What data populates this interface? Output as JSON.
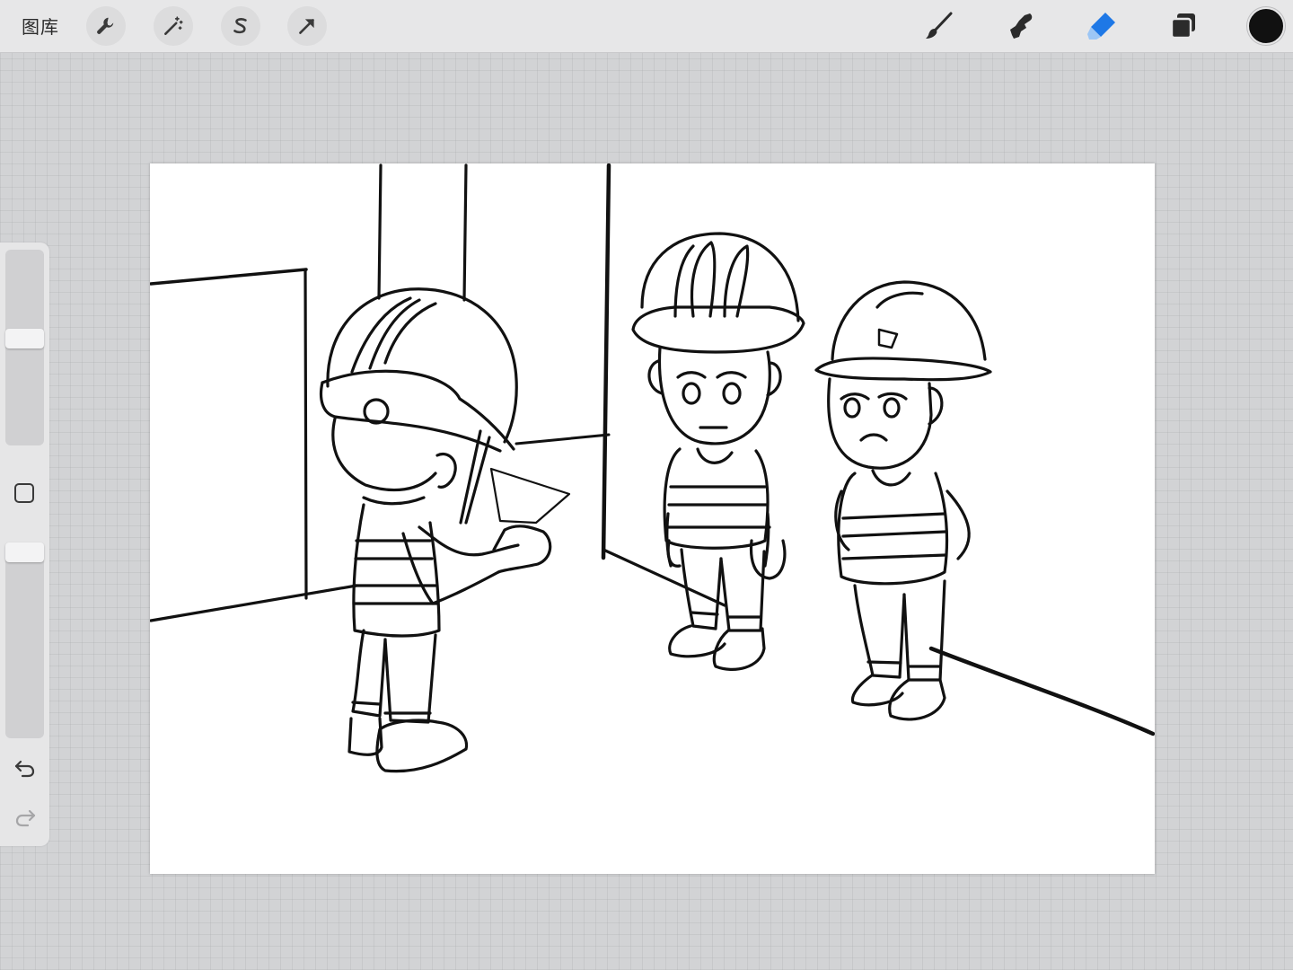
{
  "topbar": {
    "gallery_label": "图库",
    "left_tools": [
      {
        "name": "actions",
        "icon": "wrench-icon"
      },
      {
        "name": "adjustments",
        "icon": "magic-wand-icon"
      },
      {
        "name": "selection",
        "icon": "selection-s-icon"
      },
      {
        "name": "transform",
        "icon": "arrow-cursor-icon"
      }
    ],
    "right_tools": [
      {
        "name": "brush",
        "icon": "brush-icon",
        "active": false
      },
      {
        "name": "smudge",
        "icon": "smudge-icon",
        "active": false
      },
      {
        "name": "eraser",
        "icon": "eraser-icon",
        "active": true
      },
      {
        "name": "layers",
        "icon": "layers-icon",
        "active": false
      }
    ],
    "current_color": "#111111",
    "active_color": "#1e78e6"
  },
  "sidebar": {
    "brush_size_level": 0.35,
    "opacity_level": 0.97
  },
  "canvas": {
    "subject": "line-art sketch"
  }
}
